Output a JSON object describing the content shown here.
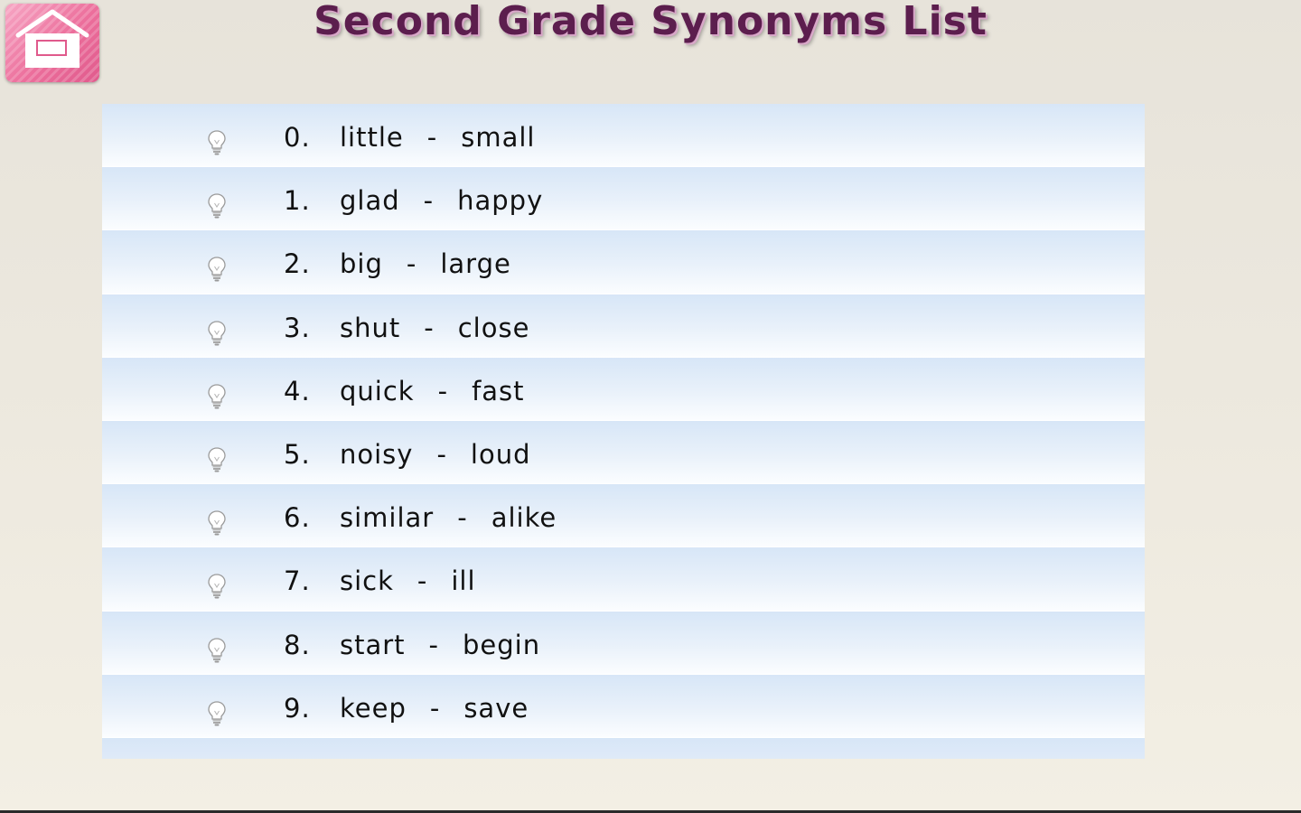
{
  "app": {
    "title": "Second Grade Synonyms List"
  },
  "home_button": {
    "icon": "home-icon",
    "color": "#ec6f9c"
  },
  "row_icon": "lightbulb-icon",
  "synonyms": [
    {
      "number": "0.",
      "word": "little",
      "separator": "-",
      "synonym": "small"
    },
    {
      "number": "1.",
      "word": "glad",
      "separator": "-",
      "synonym": "happy"
    },
    {
      "number": "2.",
      "word": "big",
      "separator": "-",
      "synonym": "large"
    },
    {
      "number": "3.",
      "word": "shut",
      "separator": "-",
      "synonym": "close"
    },
    {
      "number": "4.",
      "word": "quick",
      "separator": "-",
      "synonym": "fast"
    },
    {
      "number": "5.",
      "word": "noisy",
      "separator": "-",
      "synonym": "loud"
    },
    {
      "number": "6.",
      "word": "similar",
      "separator": "-",
      "synonym": "alike"
    },
    {
      "number": "7.",
      "word": "sick",
      "separator": "-",
      "synonym": "ill"
    },
    {
      "number": "8.",
      "word": "start",
      "separator": "-",
      "synonym": "begin"
    },
    {
      "number": "9.",
      "word": "keep",
      "separator": "-",
      "synonym": "save"
    }
  ],
  "colors": {
    "title": "#5c1e4e",
    "row_top": "#d7e6f7",
    "row_bottom": "#fbfdff",
    "background": "#ece8de"
  }
}
